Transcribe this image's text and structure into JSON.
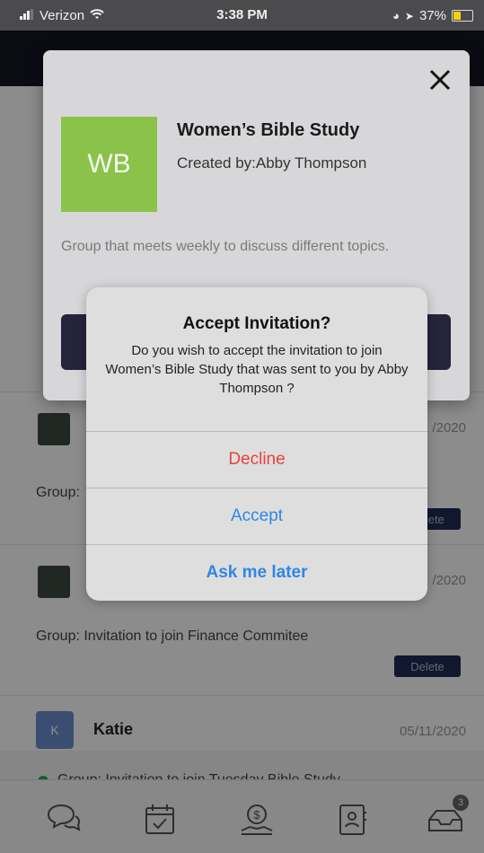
{
  "status": {
    "carrier": "Verizon",
    "time": "3:38 PM",
    "battery": "37%"
  },
  "list": {
    "rows": [
      {
        "name": "",
        "date": "/2020",
        "message": "Group:",
        "delete_label": "Delete"
      },
      {
        "name": "",
        "date": "/2020",
        "message": "Group: Invitation to join Finance Commitee",
        "delete_label": "Delete"
      },
      {
        "name": "Katie",
        "avatar_letter": "K",
        "date": "05/11/2020",
        "message": "Group: Invitation to join Tuesday Bible Study"
      }
    ]
  },
  "tabbar": {
    "items": [
      "chat-icon",
      "calendar-icon",
      "donate-icon",
      "contacts-icon",
      "inbox-icon"
    ],
    "inbox_badge": "3"
  },
  "group_card": {
    "initials": "WB",
    "title": "Women’s Bible Study",
    "creator": "Created by:Abby Thompson",
    "description": "Group that meets weekly to discuss different topics."
  },
  "alert": {
    "title": "Accept Invitation?",
    "message": "Do you wish to accept the invitation to join Women’s Bible Study that was sent to you by Abby Thompson ?",
    "decline": "Decline",
    "accept": "Accept",
    "later": "Ask me later"
  },
  "colors": {
    "accent_green": "#8bc34a",
    "destructive": "#e8433b",
    "ios_blue": "#2f87e6",
    "header_dark": "#151523"
  }
}
